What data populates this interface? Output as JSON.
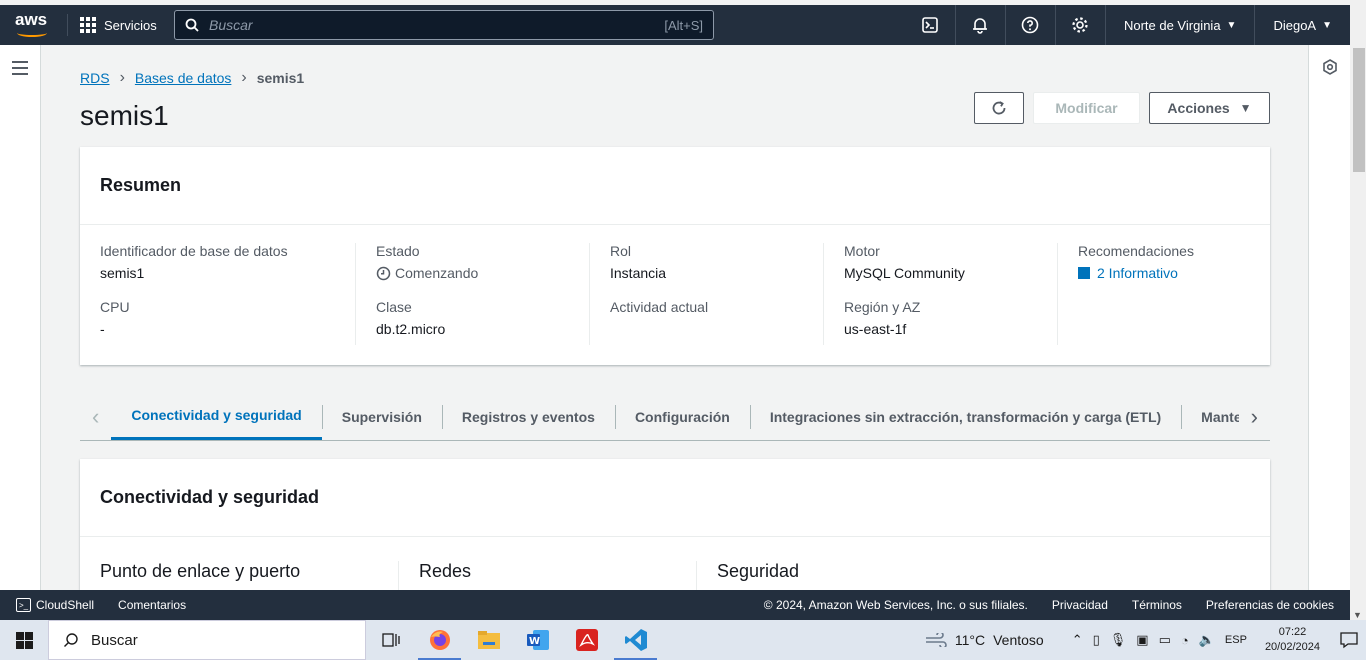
{
  "topnav": {
    "logo_text": "aws",
    "services_label": "Servicios",
    "search_placeholder": "Buscar",
    "search_shortcut": "[Alt+S]",
    "region": "Norte de Virginia",
    "user": "DiegoA"
  },
  "breadcrumb": {
    "root": "RDS",
    "parent": "Bases de datos",
    "current": "semis1"
  },
  "page": {
    "title": "semis1",
    "modify_label": "Modificar",
    "actions_label": "Acciones"
  },
  "summary": {
    "heading": "Resumen",
    "db_id_label": "Identificador de base de datos",
    "db_id_value": "semis1",
    "cpu_label": "CPU",
    "cpu_value": "-",
    "status_label": "Estado",
    "status_value": "Comenzando",
    "class_label": "Clase",
    "class_value": "db.t2.micro",
    "role_label": "Rol",
    "role_value": "Instancia",
    "activity_label": "Actividad actual",
    "engine_label": "Motor",
    "engine_value": "MySQL Community",
    "region_label": "Región y AZ",
    "region_value": "us-east-1f",
    "recs_label": "Recomendaciones",
    "recs_value": "2 Informativo"
  },
  "tabs": {
    "t1": "Conectividad y seguridad",
    "t2": "Supervisión",
    "t3": "Registros y eventos",
    "t4": "Configuración",
    "t5": "Integraciones sin extracción, transformación y carga (ETL)",
    "t6": "Mantenimiento"
  },
  "connectivity": {
    "heading": "Conectividad y seguridad",
    "col1": "Punto de enlace y puerto",
    "col2": "Redes",
    "col3": "Seguridad"
  },
  "footer": {
    "cloudshell": "CloudShell",
    "comments": "Comentarios",
    "copyright": "© 2024, Amazon Web Services, Inc. o sus filiales.",
    "privacy": "Privacidad",
    "terms": "Términos",
    "cookies": "Preferencias de cookies"
  },
  "taskbar": {
    "search_label": "Buscar",
    "temperature": "11°C",
    "weather": "Ventoso",
    "lang": "ESP",
    "time": "07:22",
    "date": "20/02/2024"
  },
  "colors": {
    "accent": "#0073bb",
    "nav_bg": "#232f3e",
    "aws_orange": "#ff9900"
  }
}
